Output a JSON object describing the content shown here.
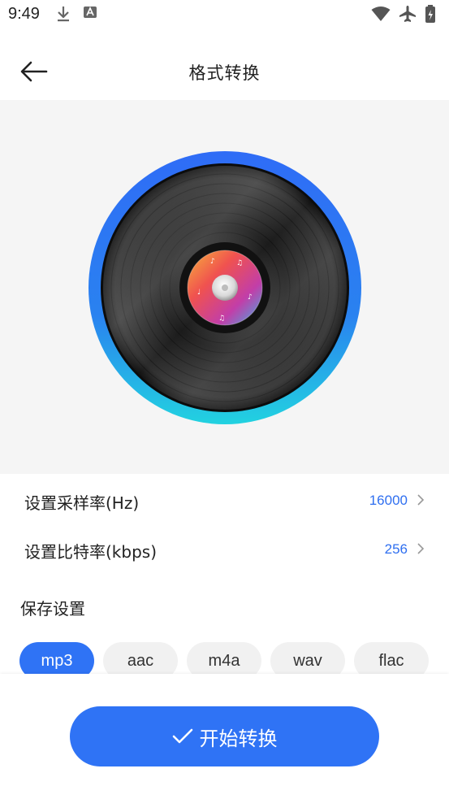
{
  "status_bar": {
    "time": "9:49",
    "icons_left": [
      "download-icon",
      "font-app-icon"
    ],
    "icons_right": [
      "wifi-icon",
      "airplane-mode-icon",
      "battery-icon"
    ]
  },
  "header": {
    "back_icon": "back-arrow-icon",
    "title": "格式转换"
  },
  "settings": {
    "sample_rate_label": "设置采样率(Hz)",
    "sample_rate_value": "16000",
    "bitrate_label": "设置比特率(kbps)",
    "bitrate_value": "256"
  },
  "save_settings": {
    "title": "保存设置",
    "formats": [
      "mp3",
      "aac",
      "m4a",
      "wav",
      "flac"
    ],
    "selected": "mp3"
  },
  "action": {
    "start_label": "开始转换"
  },
  "colors": {
    "accent": "#2f73f5",
    "value_text": "#2f6ff0",
    "hero_bg": "#f5f5f5"
  }
}
